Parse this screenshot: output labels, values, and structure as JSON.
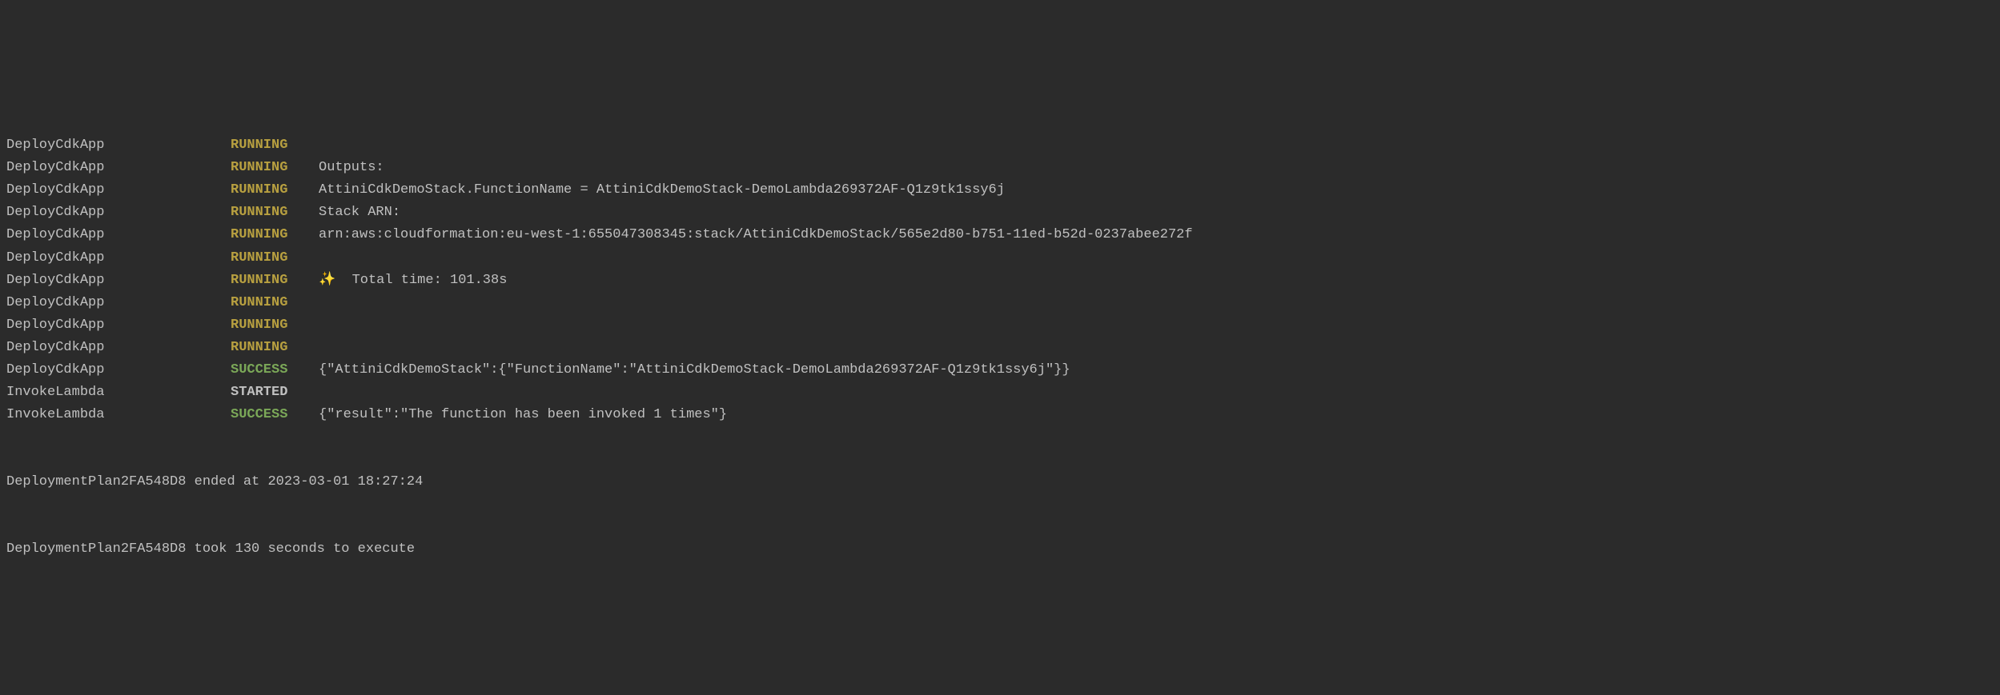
{
  "lines": [
    {
      "task": "DeployCdkApp",
      "status": "RUNNING",
      "statusClass": "status-running",
      "message": ""
    },
    {
      "task": "DeployCdkApp",
      "status": "RUNNING",
      "statusClass": "status-running",
      "message": "Outputs:"
    },
    {
      "task": "DeployCdkApp",
      "status": "RUNNING",
      "statusClass": "status-running",
      "message": "AttiniCdkDemoStack.FunctionName = AttiniCdkDemoStack-DemoLambda269372AF-Q1z9tk1ssy6j"
    },
    {
      "task": "DeployCdkApp",
      "status": "RUNNING",
      "statusClass": "status-running",
      "message": "Stack ARN:"
    },
    {
      "task": "DeployCdkApp",
      "status": "RUNNING",
      "statusClass": "status-running",
      "message": "arn:aws:cloudformation:eu-west-1:655047308345:stack/AttiniCdkDemoStack/565e2d80-b751-11ed-b52d-0237abee272f"
    },
    {
      "task": "DeployCdkApp",
      "status": "RUNNING",
      "statusClass": "status-running",
      "message": ""
    },
    {
      "task": "DeployCdkApp",
      "status": "RUNNING",
      "statusClass": "status-running",
      "message": "✨  Total time: 101.38s"
    },
    {
      "task": "DeployCdkApp",
      "status": "RUNNING",
      "statusClass": "status-running",
      "message": ""
    },
    {
      "task": "DeployCdkApp",
      "status": "RUNNING",
      "statusClass": "status-running",
      "message": ""
    },
    {
      "task": "DeployCdkApp",
      "status": "RUNNING",
      "statusClass": "status-running",
      "message": ""
    },
    {
      "task": "DeployCdkApp",
      "status": "SUCCESS",
      "statusClass": "status-success",
      "message": "{\"AttiniCdkDemoStack\":{\"FunctionName\":\"AttiniCdkDemoStack-DemoLambda269372AF-Q1z9tk1ssy6j\"}}"
    },
    {
      "task": "InvokeLambda",
      "status": "STARTED",
      "statusClass": "status-started",
      "message": ""
    },
    {
      "task": "InvokeLambda",
      "status": "SUCCESS",
      "statusClass": "status-success",
      "message": "{\"result\":\"The function has been invoked 1 times\"}"
    }
  ],
  "footer": {
    "line1": "DeploymentPlan2FA548D8 ended at 2023-03-01 18:27:24",
    "line2": "DeploymentPlan2FA548D8 took 130 seconds to execute"
  }
}
